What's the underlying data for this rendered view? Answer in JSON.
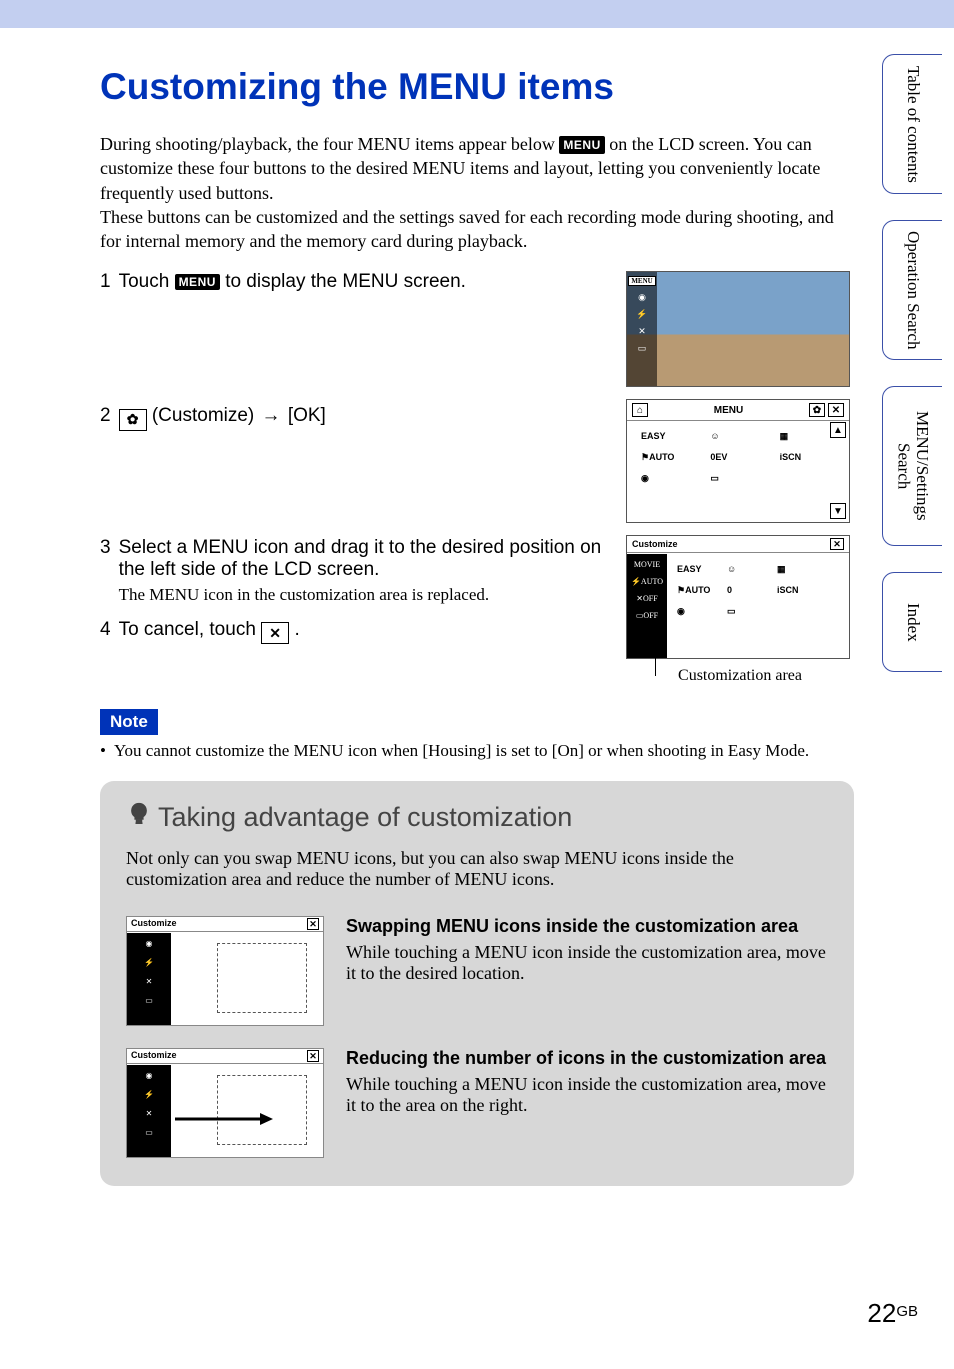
{
  "page": {
    "title": "Customizing the MENU items",
    "intro": "During shooting/playback, the four MENU items appear below  MENU  on the LCD screen. You can customize these four buttons to the desired MENU items and layout, letting you conveniently locate frequently used buttons.\nThese buttons can be customized and the settings saved for each recording mode during shooting, and for internal memory and the memory card during playback.",
    "number": "22",
    "region": "GB"
  },
  "steps": {
    "s1": {
      "num": "1",
      "text_a": "Touch",
      "text_b": "to display the MENU screen."
    },
    "s2": {
      "num": "2",
      "text_a": "(Customize)",
      "arrow": "→",
      "text_b": "[OK]"
    },
    "s3": {
      "num": "3",
      "text_a": "Select a MENU icon and drag it to the desired position on the left side of the LCD screen.",
      "sub": "The MENU icon in the customization area is replaced."
    },
    "s4": {
      "num": "4",
      "text_a": "To cancel, touch",
      "text_b": "."
    }
  },
  "icons": {
    "menu_chip": "MENU",
    "gear": "✿",
    "close": "✕"
  },
  "caption": "Customization area",
  "note": {
    "label": "Note",
    "item": "You cannot customize the MENU icon when [Housing] is set to [On] or when shooting in Easy Mode."
  },
  "tip": {
    "title": "Taking advantage of customization",
    "intro": "Not only can you swap MENU icons, but you can also swap MENU icons inside the customization area and reduce the number of MENU icons.",
    "sec1": {
      "h": "Swapping MENU icons inside the customization area",
      "p": "While touching a MENU icon inside the customization area, move it to the desired location."
    },
    "sec2": {
      "h": "Reducing the number of icons in the customization area",
      "p": "While touching a MENU icon inside the customization area, move it to the area on the right."
    },
    "img_label": "Customize"
  },
  "tabs": {
    "t1": "Table of\ncontents",
    "t2": "Operation\nSearch",
    "t3": "MENU/Settings\nSearch",
    "t4": "Index"
  },
  "shot2": {
    "title": "MENU",
    "items": [
      "EASY",
      "☺",
      "▦",
      "⚑AUTO",
      "0EV",
      "iSCN",
      "◉",
      "▭"
    ]
  },
  "shot3": {
    "title": "Customize",
    "side": [
      "MOVIE",
      "⚡AUTO",
      "✕OFF",
      "▭OFF"
    ],
    "grid": [
      "EASY",
      "☺",
      "▦",
      "⚑AUTO",
      "0",
      "iSCN",
      "◉",
      "▭"
    ]
  }
}
